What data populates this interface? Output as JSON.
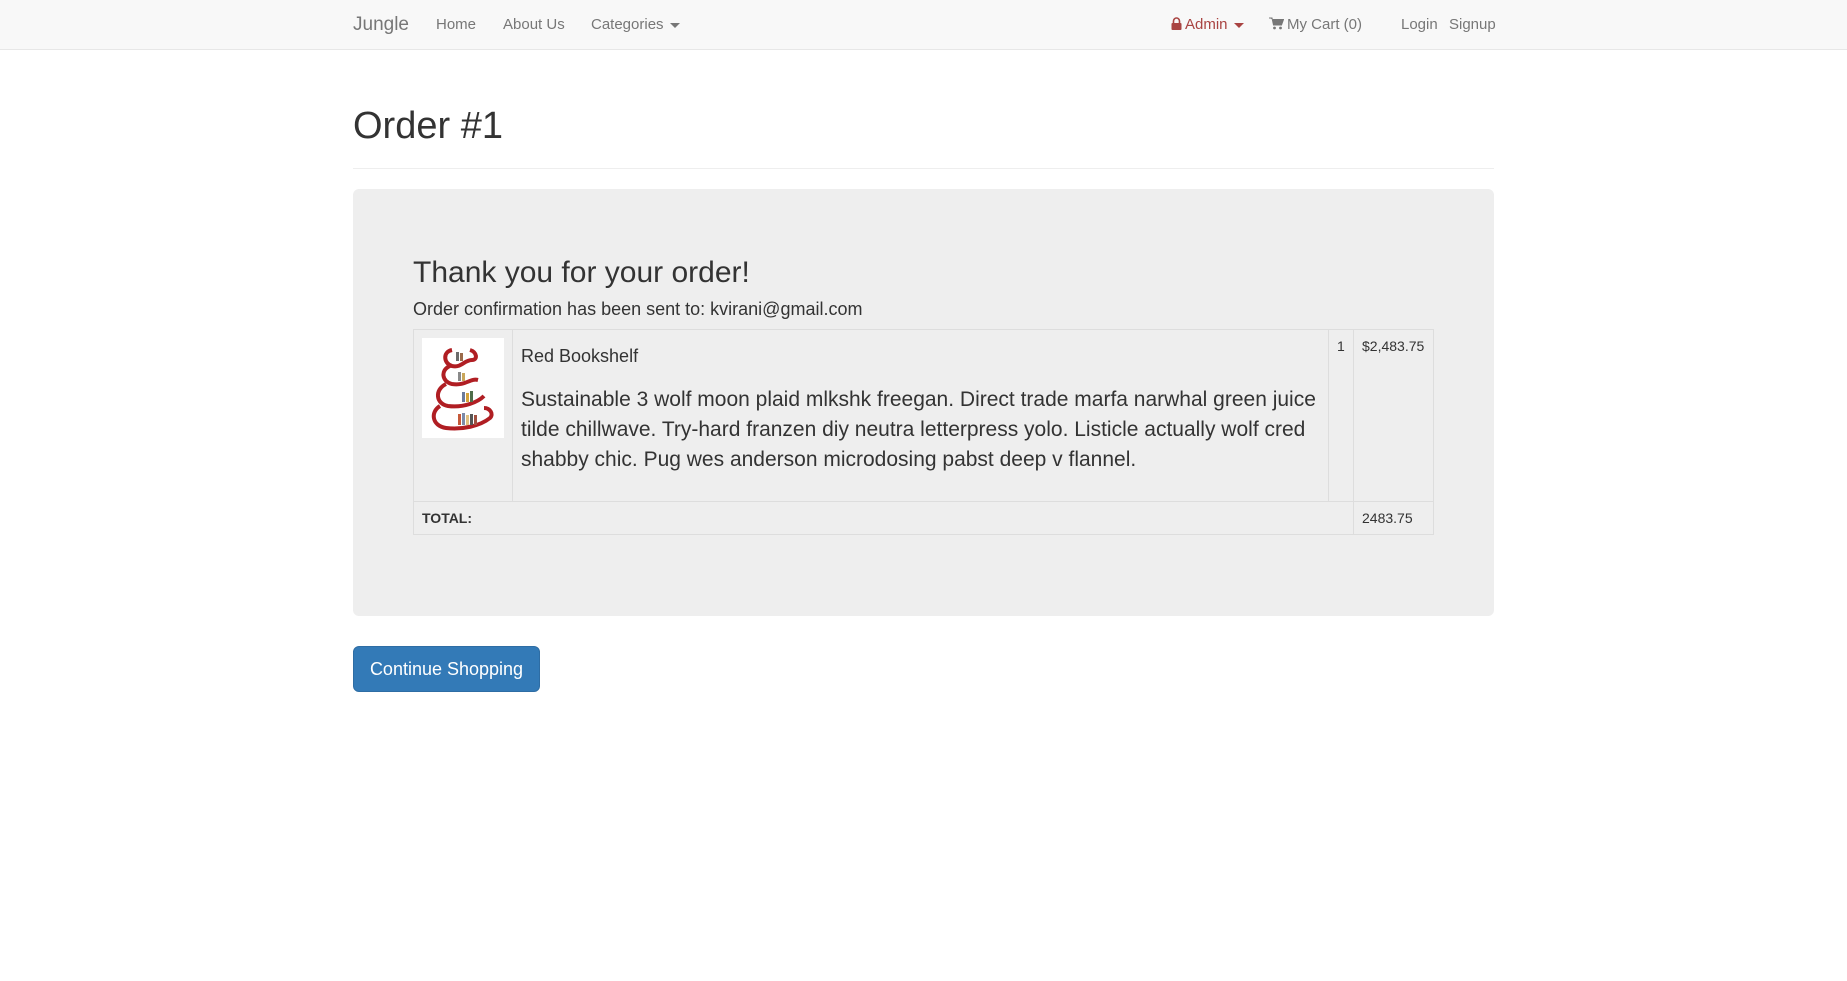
{
  "navbar": {
    "brand": "Jungle",
    "links": [
      "Home",
      "About Us",
      "Categories"
    ],
    "admin": "Admin",
    "cart": "My Cart (0)",
    "login": "Login",
    "signup": "Signup",
    "admin_color": "#a94442"
  },
  "page": {
    "title": "Order #1"
  },
  "order": {
    "thanks": "Thank you for your order!",
    "confirm_prefix": "Order confirmation has been sent to: ",
    "email": "kvirani@gmail.com",
    "items": [
      {
        "name": "Red Bookshelf",
        "description": "Sustainable 3 wolf moon plaid mlkshk freegan. Direct trade marfa narwhal green juice tilde chillwave. Try-hard franzen diy neutra letterpress yolo. Listicle actually wolf cred shabby chic. Pug wes anderson microdosing pabst deep v flannel.",
        "quantity": "1",
        "price": "$2,483.75"
      }
    ],
    "total_label": "TOTAL:",
    "total_value": "2483.75"
  },
  "actions": {
    "continue_label": "Continue Shopping",
    "primary_color": "#337ab7"
  }
}
